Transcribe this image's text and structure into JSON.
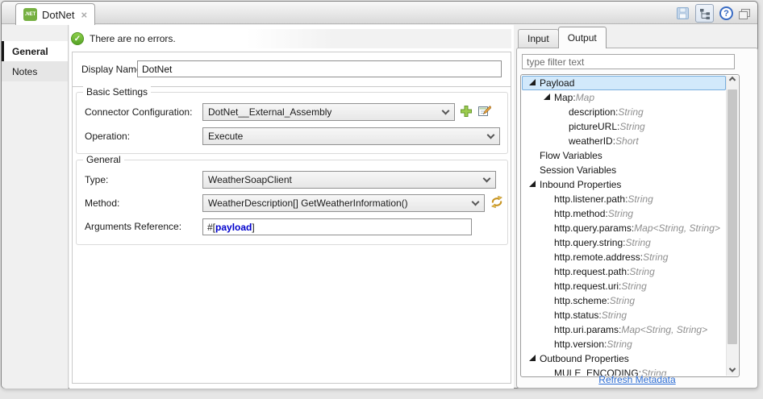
{
  "titlebar": {
    "tab": {
      "icon_text": ".NET",
      "label": "DotNet",
      "close": "×"
    },
    "icons": [
      "save-icon",
      "tree-view-icon",
      "help-icon",
      "restore-window-icon"
    ]
  },
  "sidebar": {
    "items": [
      {
        "label": "General",
        "selected": true
      },
      {
        "label": "Notes",
        "selected": false
      }
    ]
  },
  "editor": {
    "status_message": "There are no errors.",
    "display_name": {
      "label": "Display Name:",
      "value": "DotNet"
    },
    "basic_settings": {
      "legend": "Basic Settings",
      "connector_configuration": {
        "label": "Connector Configuration:",
        "value": "DotNet__External_Assembly"
      },
      "operation": {
        "label": "Operation:",
        "value": "Execute"
      }
    },
    "general": {
      "legend": "General",
      "type": {
        "label": "Type:",
        "value": "WeatherSoapClient"
      },
      "method": {
        "label": "Method:",
        "value": "WeatherDescription[] GetWeatherInformation()"
      },
      "arguments_reference": {
        "label": "Arguments Reference:",
        "prefix": "#[",
        "expression": "payload",
        "suffix": "]"
      }
    }
  },
  "metadata_panel": {
    "tabs": [
      {
        "label": "Input",
        "active": false
      },
      {
        "label": "Output",
        "active": true
      }
    ],
    "filter_placeholder": "type filter text",
    "tree": [
      {
        "label": "Payload",
        "level": 0,
        "expanded": true,
        "selected": true
      },
      {
        "label": "Map",
        "type": "Map",
        "level": 1,
        "expanded": true
      },
      {
        "label": "description",
        "type": "String",
        "level": 2
      },
      {
        "label": "pictureURL",
        "type": "String",
        "level": 2
      },
      {
        "label": "weatherID",
        "type": "Short",
        "level": 2
      },
      {
        "label": "Flow Variables",
        "level": 0
      },
      {
        "label": "Session Variables",
        "level": 0
      },
      {
        "label": "Inbound Properties",
        "level": 0,
        "expanded": true
      },
      {
        "label": "http.listener.path",
        "type": "String",
        "level": 1
      },
      {
        "label": "http.method",
        "type": "String",
        "level": 1
      },
      {
        "label": "http.query.params",
        "type": "Map<String, String>",
        "level": 1
      },
      {
        "label": "http.query.string",
        "type": "String",
        "level": 1
      },
      {
        "label": "http.remote.address",
        "type": "String",
        "level": 1
      },
      {
        "label": "http.request.path",
        "type": "String",
        "level": 1
      },
      {
        "label": "http.request.uri",
        "type": "String",
        "level": 1
      },
      {
        "label": "http.scheme",
        "type": "String",
        "level": 1
      },
      {
        "label": "http.status",
        "type": "String",
        "level": 1
      },
      {
        "label": "http.uri.params",
        "type": "Map<String, String>",
        "level": 1
      },
      {
        "label": "http.version",
        "type": "String",
        "level": 1
      },
      {
        "label": "Outbound Properties",
        "level": 0,
        "expanded": true
      },
      {
        "label": "MULE_ENCODING",
        "type": "String",
        "level": 1
      }
    ],
    "refresh_link": "Refresh Metadata"
  }
}
